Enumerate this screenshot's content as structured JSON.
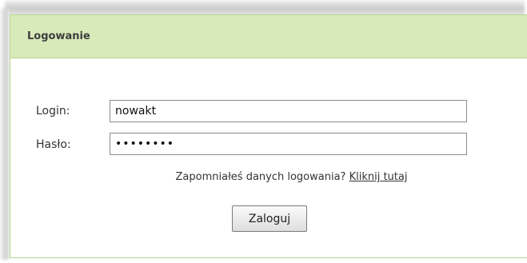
{
  "panel": {
    "title": "Logowanie"
  },
  "form": {
    "login_label": "Login:",
    "login_value": "nowakt",
    "password_label": "Hasło:",
    "password_value": "••••••••",
    "forgot_text": "Zapomniałeś danych logowania? ",
    "forgot_link": "Kliknij tutaj",
    "submit_label": "Zaloguj"
  },
  "colors": {
    "header_bg": "#d8eaba",
    "border": "#b9d58e"
  }
}
